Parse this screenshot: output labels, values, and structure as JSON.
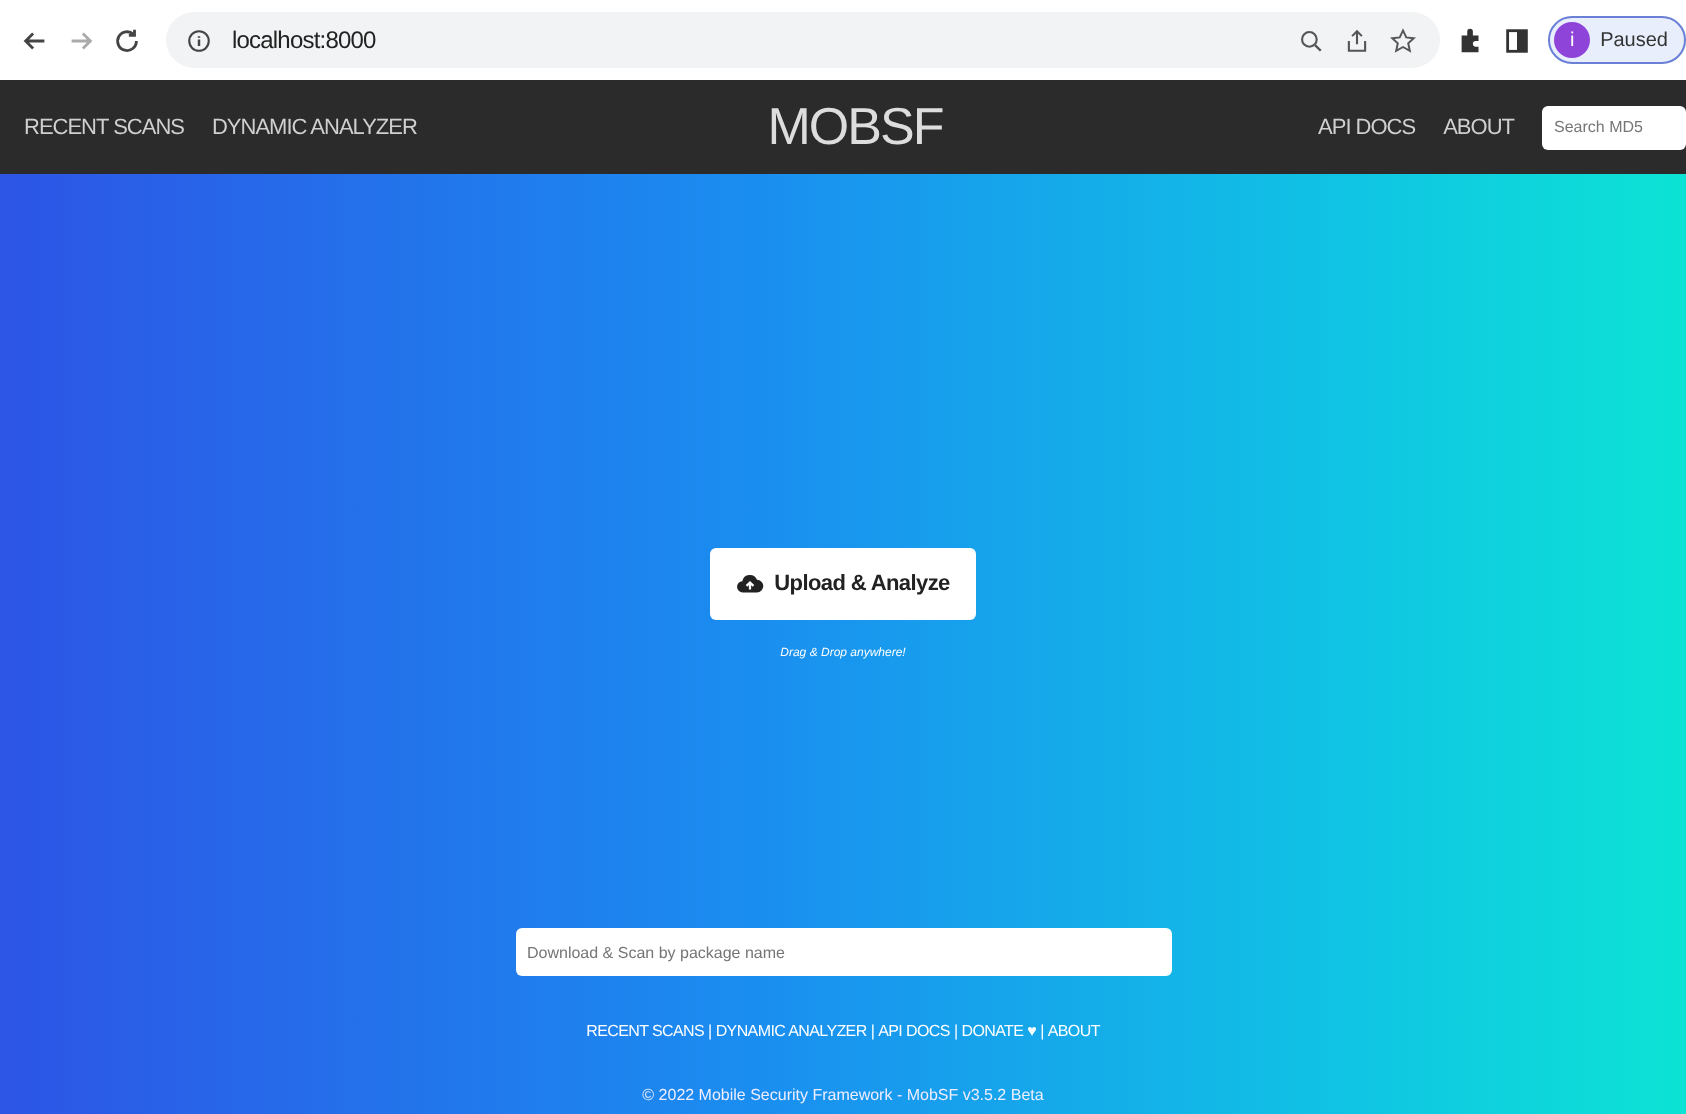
{
  "browser": {
    "url": "localhost:8000",
    "profile_initial": "i",
    "profile_status": "Paused"
  },
  "navbar": {
    "left_links": [
      "RECENT SCANS",
      "DYNAMIC ANALYZER"
    ],
    "logo": "MOB**SF**",
    "right_links": [
      "API DOCS",
      "ABOUT"
    ],
    "search": {
      "placeholder": "Search MD5"
    }
  },
  "upload": {
    "button": "Upload & Analyze",
    "hint": "Drag & Drop anywhere!"
  },
  "package_search": {
    "placeholder": "Download & Scan by package name"
  },
  "footer": {
    "links": [
      "RECENT SCANS",
      "DYNAMIC ANALYZER",
      "API DOCS",
      "DONATE ♥",
      "ABOUT"
    ],
    "separator": "|",
    "copyright": "© 2022 Mobile Security Framework - MobSF v3.5.2 Beta"
  }
}
